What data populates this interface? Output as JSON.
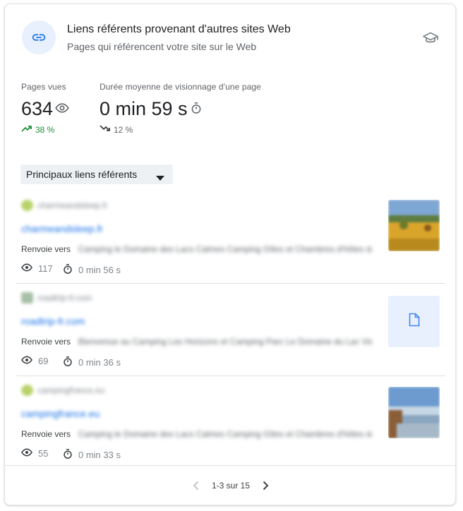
{
  "header": {
    "title": "Liens référents provenant d'autres sites Web",
    "subtitle": "Pages qui référencent votre site sur le Web"
  },
  "metrics": {
    "views": {
      "label": "Pages vues",
      "value": "634",
      "change": "38 %",
      "trend": "up"
    },
    "duration": {
      "label": "Durée moyenne de visionnage d'une page",
      "value": "0 min 59 s",
      "change": "12 %",
      "trend": "down"
    }
  },
  "dropdown": {
    "label": "Principaux liens référents"
  },
  "referrers": [
    {
      "domain": "charmeandsleep.fr",
      "link": "charmeandsleep.fr",
      "renvoie_label": "Renvoie vers",
      "target": "Camping le Domaine des Lacs Calmes Camping Gîtes et Chambres d'hôtes dans la Vienne",
      "views": "117",
      "duration": "0 min 56 s",
      "thumb": "landscape"
    },
    {
      "domain": "roadtrip-fr.com",
      "link": "roadtrip-fr.com",
      "renvoie_label": "Renvoie vers",
      "target": "Bienvenue au Camping Les Horizons et Camping Parc Le Domaine du Lac Vienne en France",
      "views": "69",
      "duration": "0 min 36 s",
      "thumb": "document"
    },
    {
      "domain": "campingfrance.eu",
      "link": "campingfrance.eu",
      "renvoie_label": "Renvoie vers",
      "target": "Camping le Domaine des Lacs Calmes Camping Gîtes et Chambres d'hôtes dans la Vienne",
      "views": "55",
      "duration": "0 min 33 s",
      "thumb": "lake"
    }
  ],
  "pagination": {
    "text": "1-3 sur 15"
  },
  "colors": {
    "accent": "#1a73e8",
    "positive": "#1e8e3e",
    "neutral": "#5f6368",
    "icon_bg": "#e8f0fe"
  },
  "icons": {
    "header": "link-icon",
    "learn": "school-icon",
    "views": "eye-icon",
    "duration": "timer-icon"
  }
}
